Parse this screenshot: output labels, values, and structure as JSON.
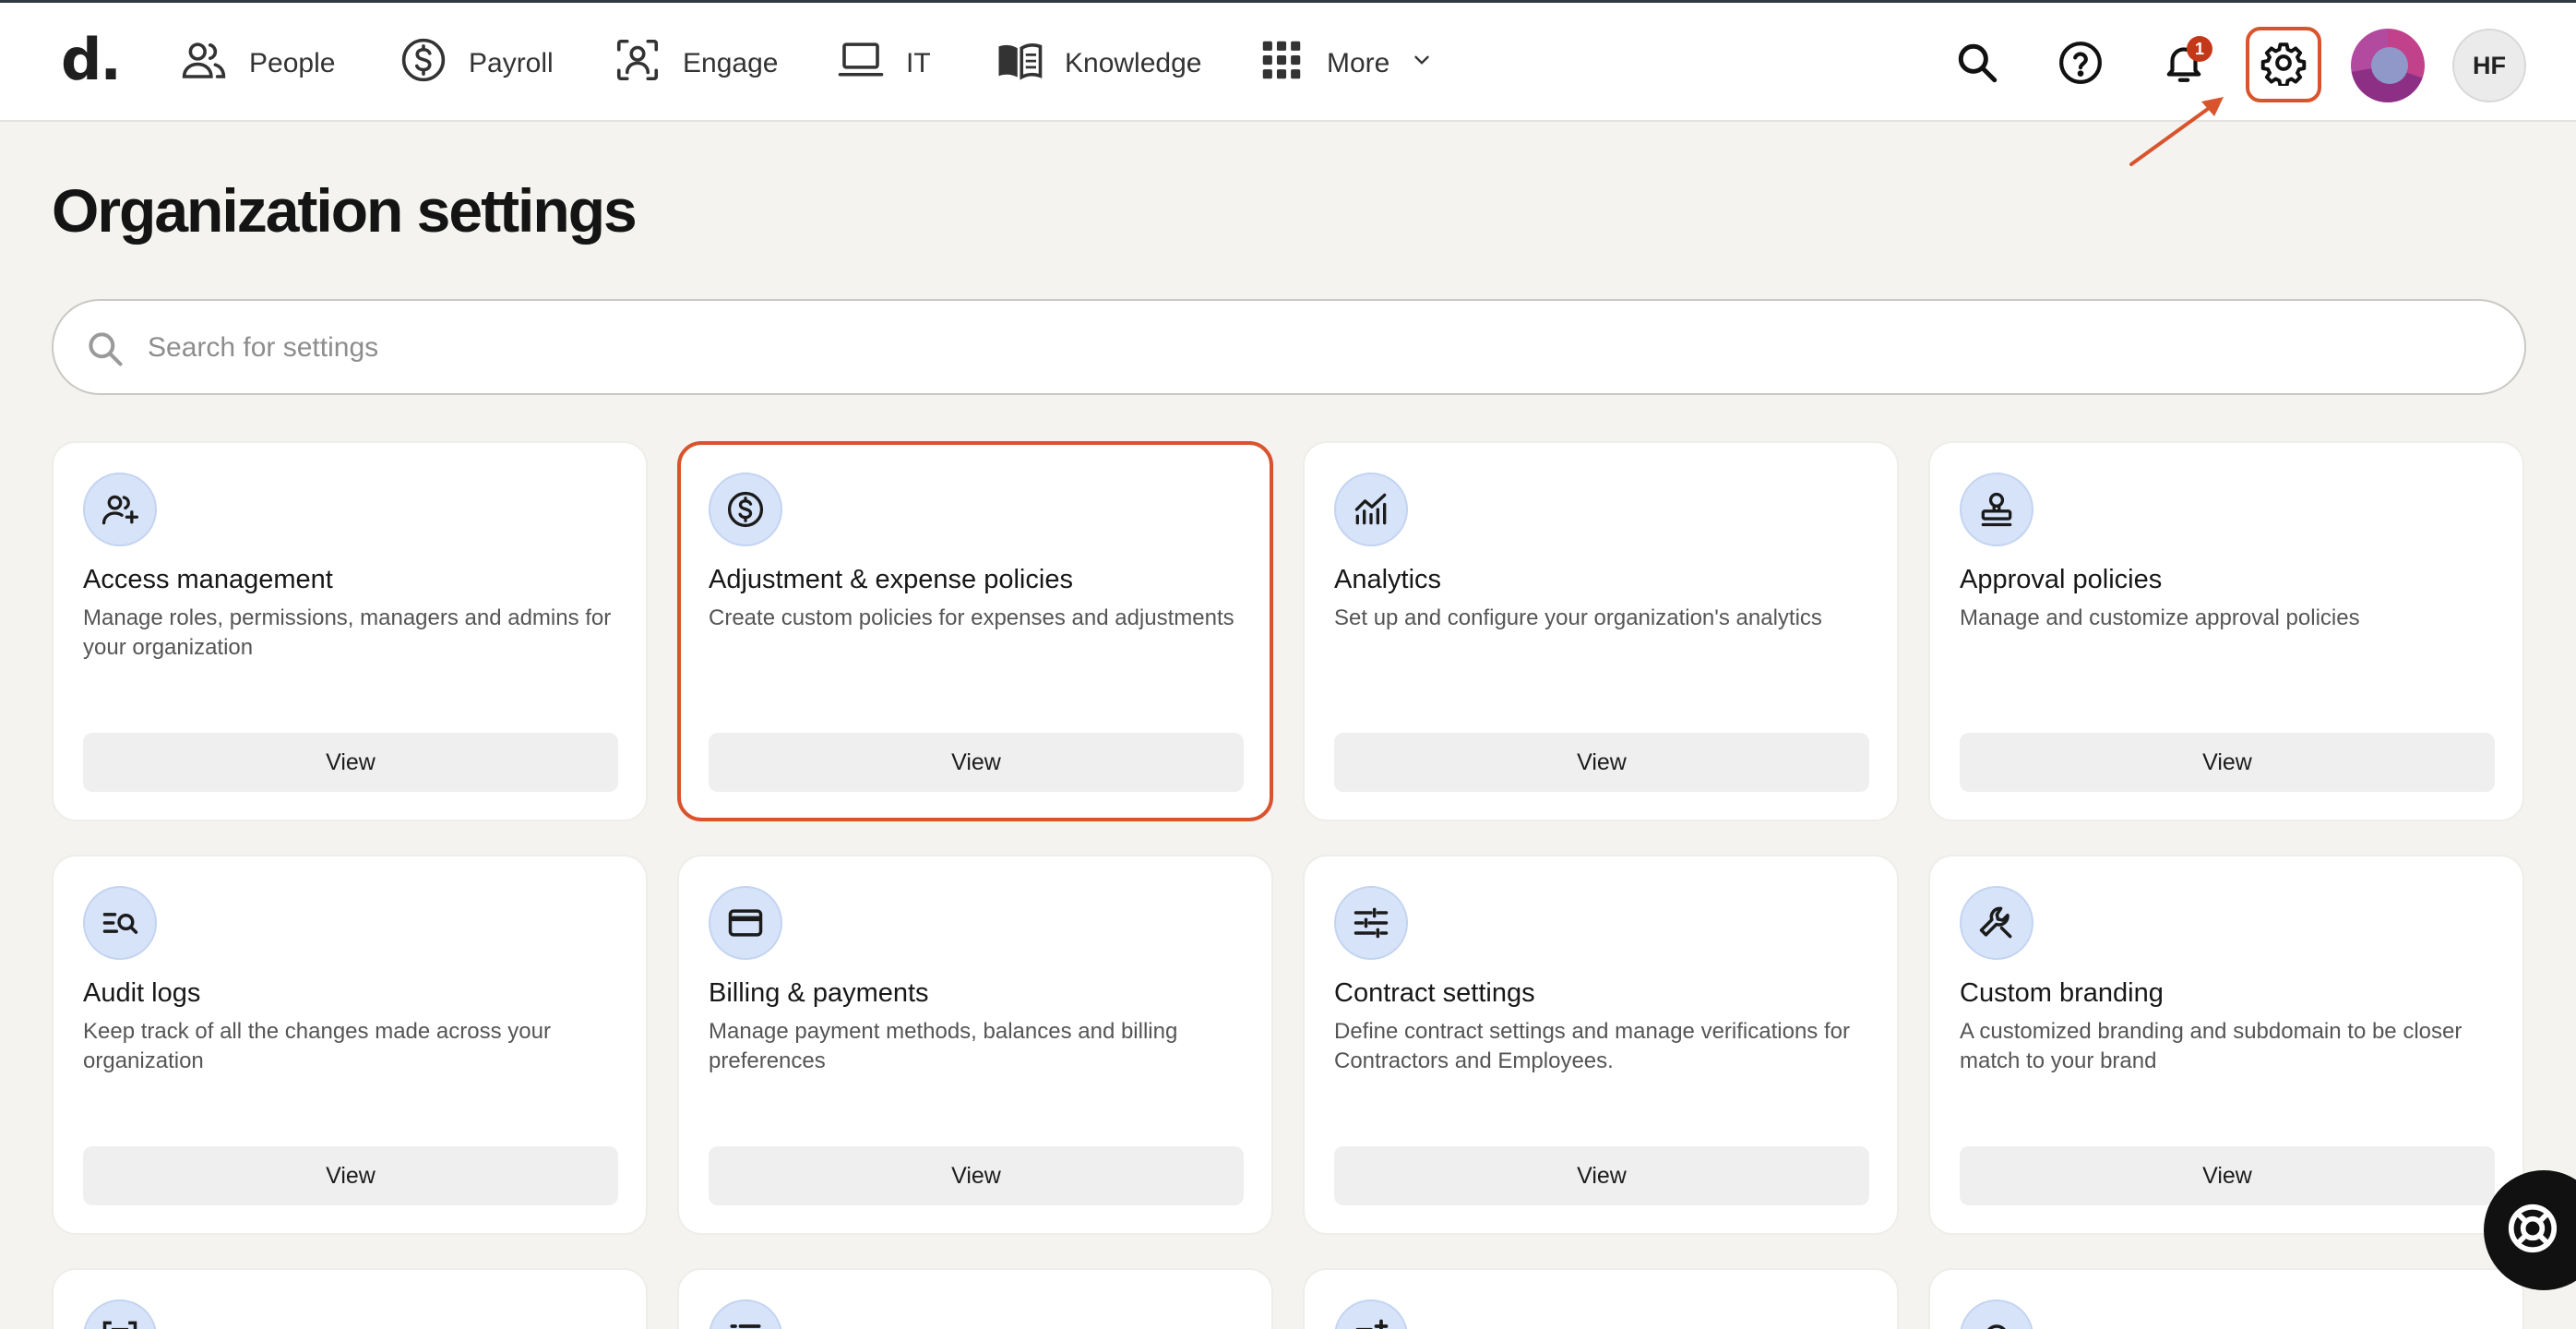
{
  "nav": {
    "logo": "d.",
    "items": [
      {
        "label": "People",
        "icon": "people-icon"
      },
      {
        "label": "Payroll",
        "icon": "dollar-circle-icon"
      },
      {
        "label": "Engage",
        "icon": "engage-icon"
      },
      {
        "label": "IT",
        "icon": "laptop-icon"
      },
      {
        "label": "Knowledge",
        "icon": "book-icon"
      },
      {
        "label": "More",
        "icon": "grid-icon"
      }
    ],
    "notification_count": "1",
    "user_initials": "HF"
  },
  "page": {
    "title": "Organization settings",
    "search_placeholder": "Search for settings"
  },
  "cards": [
    {
      "title": "Access management",
      "description": "Manage roles, permissions, managers and admins for your organization",
      "button": "View",
      "icon": "user-add-icon"
    },
    {
      "title": "Adjustment & expense policies",
      "description": "Create custom policies for expenses and adjustments",
      "button": "View",
      "icon": "dollar-circle-icon",
      "highlighted": true
    },
    {
      "title": "Analytics",
      "description": "Set up and configure your organization's analytics",
      "button": "View",
      "icon": "analytics-icon"
    },
    {
      "title": "Approval policies",
      "description": "Manage and customize approval policies",
      "button": "View",
      "icon": "stamp-icon"
    },
    {
      "title": "Audit logs",
      "description": "Keep track of all the changes made across your organization",
      "button": "View",
      "icon": "list-search-icon"
    },
    {
      "title": "Billing & payments",
      "description": "Manage payment methods, balances and billing preferences",
      "button": "View",
      "icon": "credit-card-icon"
    },
    {
      "title": "Contract settings",
      "description": "Define contract settings and manage verifications for Contractors and Employees.",
      "button": "View",
      "icon": "sliders-icon"
    },
    {
      "title": "Custom branding",
      "description": "A customized branding and subdomain to be closer match to your brand",
      "button": "View",
      "icon": "wrench-icon"
    }
  ],
  "colors": {
    "accent_highlight": "#d9542c",
    "icon_circle": "#d6e3f8",
    "page_background": "#f4f3f0",
    "notification_badge": "#c4381a"
  }
}
